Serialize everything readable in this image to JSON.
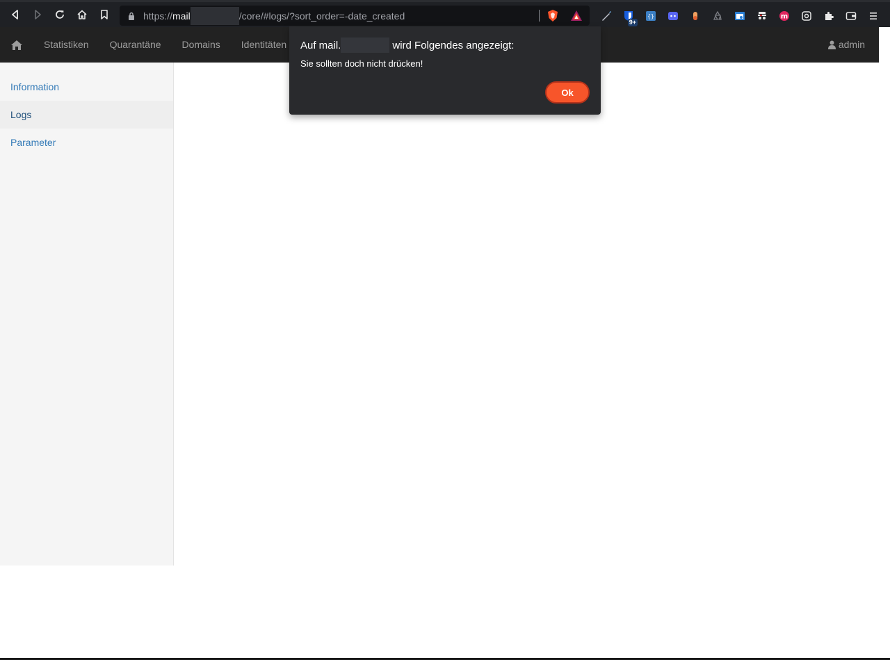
{
  "browser": {
    "url_scheme": "https://",
    "url_host": "mail",
    "url_path": "/core/#logs/?sort_order=-date_created",
    "extension_badge": "9+"
  },
  "app_nav": {
    "items": [
      "Statistiken",
      "Quarantäne",
      "Domains",
      "Identitäten"
    ],
    "user": "admin"
  },
  "sidebar": {
    "items": [
      {
        "label": "Information",
        "active": false
      },
      {
        "label": "Logs",
        "active": true
      },
      {
        "label": "Parameter",
        "active": false
      }
    ]
  },
  "dialog": {
    "title_prefix": "Auf mail.",
    "title_suffix": "wird Folgendes angezeigt:",
    "message": "Sie sollten doch nicht drücken!",
    "ok_label": "Ok",
    "accent": "#f7552a"
  },
  "colors": {
    "nav_bg": "#222222",
    "link": "#337ab7"
  }
}
